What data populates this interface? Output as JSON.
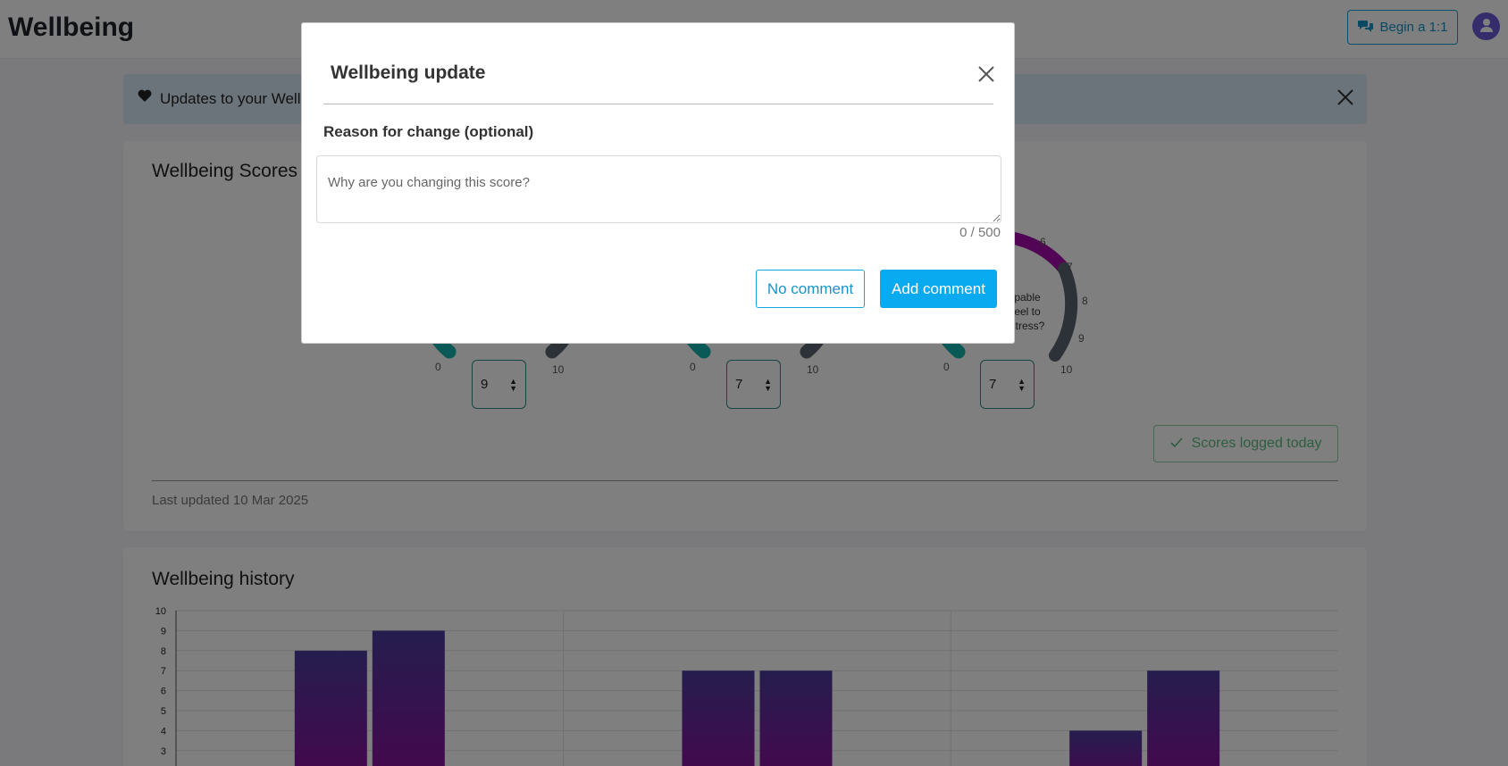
{
  "header": {
    "title": "Wellbeing",
    "begin_button": "Begin a 1:1",
    "avatar_icon": "user-avatar-icon"
  },
  "alert": {
    "text": "Updates to your Wellbeing"
  },
  "scores": {
    "title": "Wellbeing Scores",
    "gauges": [
      {
        "min_label": "0",
        "max_label": "10",
        "value": "9"
      },
      {
        "min_label": "0",
        "max_label": "10",
        "value": "7"
      },
      {
        "min_label": "0",
        "max_label": "10",
        "value": "7",
        "ticks": [
          "6",
          "7",
          "8",
          "9"
        ],
        "question": [
          "pable",
          "eel to",
          "stress?"
        ]
      }
    ],
    "logged_button": "Scores logged today",
    "last_updated": "Last updated 10 Mar 2025"
  },
  "history": {
    "title": "Wellbeing history"
  },
  "chart_data": {
    "type": "bar",
    "title": "Wellbeing history",
    "ylim": [
      0,
      10
    ],
    "y_ticks": [
      3,
      4,
      5,
      6,
      7,
      8,
      9,
      10
    ],
    "grid": true,
    "groups": [
      {
        "values": [
          8,
          9
        ]
      },
      {
        "values": [
          7,
          7
        ]
      },
      {
        "values": [
          4,
          7
        ]
      }
    ],
    "colors": {
      "bar_top": "#4b3c9e",
      "bar_bottom": "#8b0f9a"
    }
  },
  "modal": {
    "title": "Wellbeing update",
    "label": "Reason for change (optional)",
    "placeholder": "Why are you changing this score?",
    "char_count": "0 / 500",
    "no_comment_label": "No comment",
    "add_comment_label": "Add comment"
  },
  "colors": {
    "accent": "#0aaaf0",
    "teal": "#13b2ac",
    "magenta": "#a20aa8",
    "gray_arc": "#5b6470"
  }
}
